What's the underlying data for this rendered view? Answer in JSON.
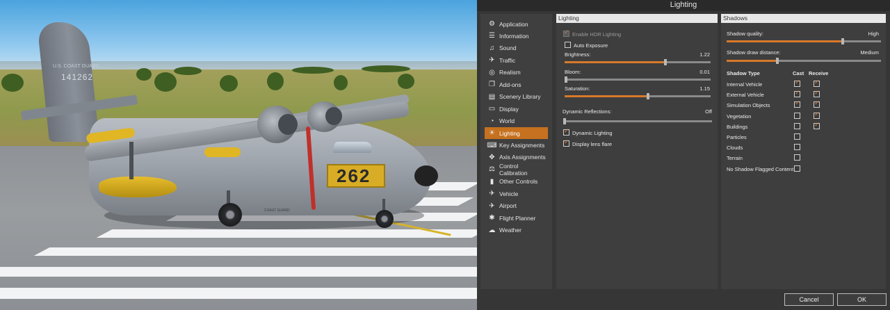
{
  "window_title": "Lighting",
  "scene": {
    "tail_number": "141262",
    "tail_text": "U.S. COAST GUARD",
    "fuselage_number": "262",
    "fuselage_text": "COAST GUARD"
  },
  "sidebar": {
    "items": [
      {
        "label": "Application",
        "icon": "gears-icon",
        "glyph": "⚙"
      },
      {
        "label": "Information",
        "icon": "list-icon",
        "glyph": "☰"
      },
      {
        "label": "Sound",
        "icon": "speaker-icon",
        "glyph": "♫"
      },
      {
        "label": "Traffic",
        "icon": "traffic-icon",
        "glyph": "✈"
      },
      {
        "label": "Realism",
        "icon": "realism-icon",
        "glyph": "◎"
      },
      {
        "label": "Add-ons",
        "icon": "plugin-icon",
        "glyph": "❐"
      },
      {
        "label": "Scenery Library",
        "icon": "folder-icon",
        "glyph": "▤"
      },
      {
        "label": "Display",
        "icon": "monitor-icon",
        "glyph": "▭"
      },
      {
        "label": "World",
        "icon": "globe-icon",
        "glyph": "◔"
      },
      {
        "label": "Lighting",
        "icon": "lighting-icon",
        "glyph": "☀"
      },
      {
        "label": "Key Assignments",
        "icon": "keyboard-icon",
        "glyph": "⌨"
      },
      {
        "label": "Axis Assignments",
        "icon": "joystick-icon",
        "glyph": "✥"
      },
      {
        "label": "Control Calibration",
        "icon": "calibration-icon",
        "glyph": "⚖"
      },
      {
        "label": "Other Controls",
        "icon": "controller-icon",
        "glyph": "▮"
      },
      {
        "label": "Vehicle",
        "icon": "airplane-icon",
        "glyph": "✈"
      },
      {
        "label": "Airport",
        "icon": "airport-icon",
        "glyph": "✈"
      },
      {
        "label": "Flight Planner",
        "icon": "route-icon",
        "glyph": "✱"
      },
      {
        "label": "Weather",
        "icon": "cloud-icon",
        "glyph": "☁"
      }
    ],
    "active": "Lighting"
  },
  "lighting": {
    "header": "Lighting",
    "enable_hdr": {
      "label": "Enable HDR Lighting",
      "checked": true,
      "disabled": true
    },
    "auto_exposure": {
      "label": "Auto Exposure",
      "checked": false
    },
    "brightness": {
      "label": "Brightness:",
      "value": "1.22",
      "fraction": 0.69
    },
    "bloom": {
      "label": "Bloom:",
      "value": "0.01",
      "fraction": 0.0
    },
    "saturation": {
      "label": "Saturation:",
      "value": "1.15",
      "fraction": 0.57
    },
    "dynamic_reflections": {
      "label": "Dynamic Reflections:",
      "value": "Off",
      "fraction": 0.0
    },
    "dynamic_lighting": {
      "label": "Dynamic Lighting",
      "checked": true
    },
    "lens_flare": {
      "label": "Display lens flare",
      "checked": true
    }
  },
  "shadows": {
    "header": "Shadows",
    "quality": {
      "label": "Shadow quality:",
      "value": "High",
      "fraction": 0.75
    },
    "draw_distance": {
      "label": "Shadow draw distance:",
      "value": "Medium",
      "fraction": 0.33
    },
    "columns": {
      "type": "Shadow Type",
      "cast": "Cast",
      "receive": "Receive"
    },
    "rows": [
      {
        "label": "Internal Vehicle",
        "cast": true,
        "receive": true
      },
      {
        "label": "External Vehicle",
        "cast": true,
        "receive": true
      },
      {
        "label": "Simulation Objects",
        "cast": true,
        "receive": true
      },
      {
        "label": "Vegetation",
        "cast": false,
        "receive": true
      },
      {
        "label": "Buildings",
        "cast": false,
        "receive": true
      },
      {
        "label": "Particles",
        "cast": false,
        "receive": null
      },
      {
        "label": "Clouds",
        "cast": false,
        "receive": null
      },
      {
        "label": "Terrain",
        "cast": false,
        "receive": null
      },
      {
        "label": "No Shadow Flagged Content",
        "cast": false,
        "receive": null
      }
    ]
  },
  "buttons": {
    "cancel": "Cancel",
    "ok": "OK"
  },
  "colors": {
    "accent": "#c5711f",
    "slider_fill": "#d8792a",
    "panel": "#3e3e3e",
    "header": "#e8e8e8"
  }
}
